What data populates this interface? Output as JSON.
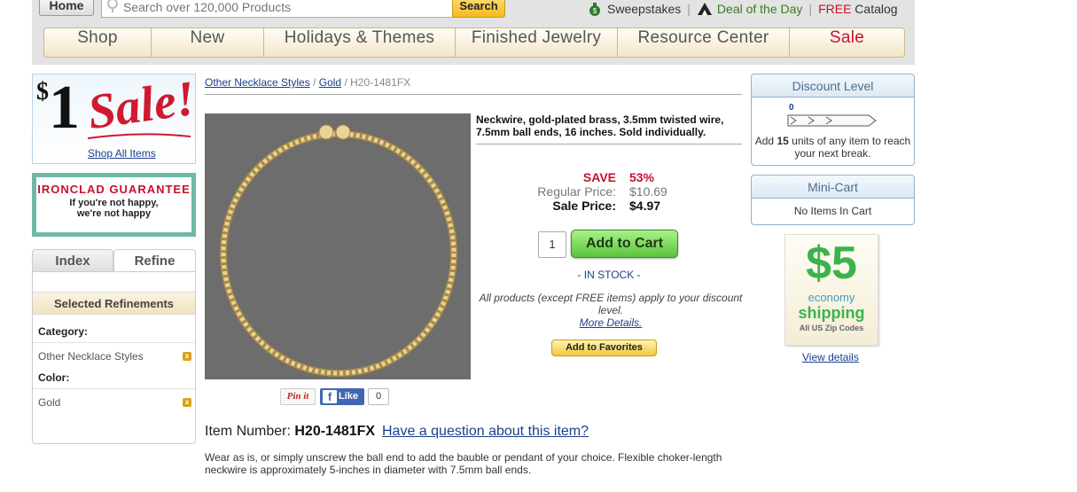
{
  "header": {
    "home_label": "Home",
    "search_placeholder": "Search over 120,000 Products",
    "search_button": "Search",
    "util_links": [
      "Sweepstakes",
      "Deal of the Day",
      "FREE",
      "Catalog"
    ]
  },
  "nav": {
    "items": [
      "Shop",
      "New",
      "Holidays & Themes",
      "Finished Jewelry",
      "Resource Center",
      "Sale"
    ]
  },
  "left": {
    "sale_ad": {
      "dollar": "$",
      "amount": "1",
      "word": "Sale!",
      "link": "Shop All Items"
    },
    "guarantee": {
      "title": "IRONCLAD GUARANTEE",
      "line1": "If you're not happy,",
      "line2": "we're not happy"
    },
    "tabs": [
      "Index",
      "Refine"
    ],
    "refine": {
      "heading": "Selected Refinements",
      "category_label": "Category:",
      "category_value": "Other Necklace Styles",
      "color_label": "Color:",
      "color_value": "Gold",
      "remove_glyph": "x"
    }
  },
  "product": {
    "breadcrumb": [
      "Other Necklace Styles",
      "Gold",
      "H20-1481FX"
    ],
    "breadcrumb_sep": "/",
    "title": "Neckwire, gold-plated brass, 3.5mm twisted wire, 7.5mm ball ends, 16 inches. Sold individually.",
    "save_label": "SAVE",
    "save_value": "53%",
    "regular_label": "Regular Price:",
    "regular_value": "$10.69",
    "sale_label": "Sale Price:",
    "sale_value": "$4.97",
    "quantity": "1",
    "add_to_cart": "Add to Cart",
    "stock": "- IN STOCK -",
    "discount_note": "All products (except FREE items) apply to your discount level.",
    "more_details": "More Details.",
    "add_to_favorites": "Add to Favorites",
    "pinit": "Pin it",
    "fb_icon": "f",
    "fb_like": "Like",
    "fb_count": "0",
    "item_number_label": "Item Number:",
    "item_number": "H20-1481FX",
    "question_link": "Have a question about this item?",
    "description": "Wear as is, or simply unscrew the ball end to add the bauble or pendant of your choice. Flexible choker-length neckwire is approximately 5-inches in diameter with 7.5mm ball ends."
  },
  "right": {
    "discount": {
      "heading": "Discount Level",
      "level": "0",
      "text_pre": "Add",
      "units": "15",
      "text_post": "units of any item to reach your next break."
    },
    "minicart": {
      "heading": "Mini-Cart",
      "text": "No Items In Cart"
    },
    "shipping_ad": {
      "amount": "$5",
      "line1": "economy",
      "line2": "shipping",
      "line3": "All US Zip Codes"
    },
    "view_details": "View details"
  },
  "colors": {
    "accent_red": "#c8102e",
    "link_blue": "#1a3f8c",
    "cart_green": "#5bc43c",
    "nav_bg": "#f2e6c8"
  }
}
